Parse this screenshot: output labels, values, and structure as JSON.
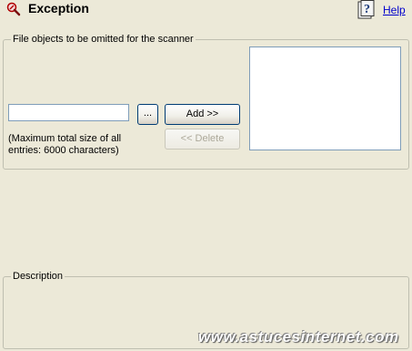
{
  "header": {
    "title": "Exception",
    "help_label": "Help",
    "icon": "exception-icon",
    "help_icon": "help-question-icon"
  },
  "file_objects": {
    "legend": "File objects to be omitted for the scanner",
    "input_value": "",
    "browse_label": "...",
    "add_label": "Add >>",
    "delete_label": "<< Delete",
    "max_size_note": "(Maximum total size of all entries: 6000 characters)",
    "list_items": []
  },
  "description": {
    "legend": "Description"
  },
  "watermark": "www.astucesinternet.com",
  "colors": {
    "background": "#ECE9D8",
    "link": "#0000CC",
    "button_border": "#003C74",
    "input_border": "#7F9DB9"
  }
}
